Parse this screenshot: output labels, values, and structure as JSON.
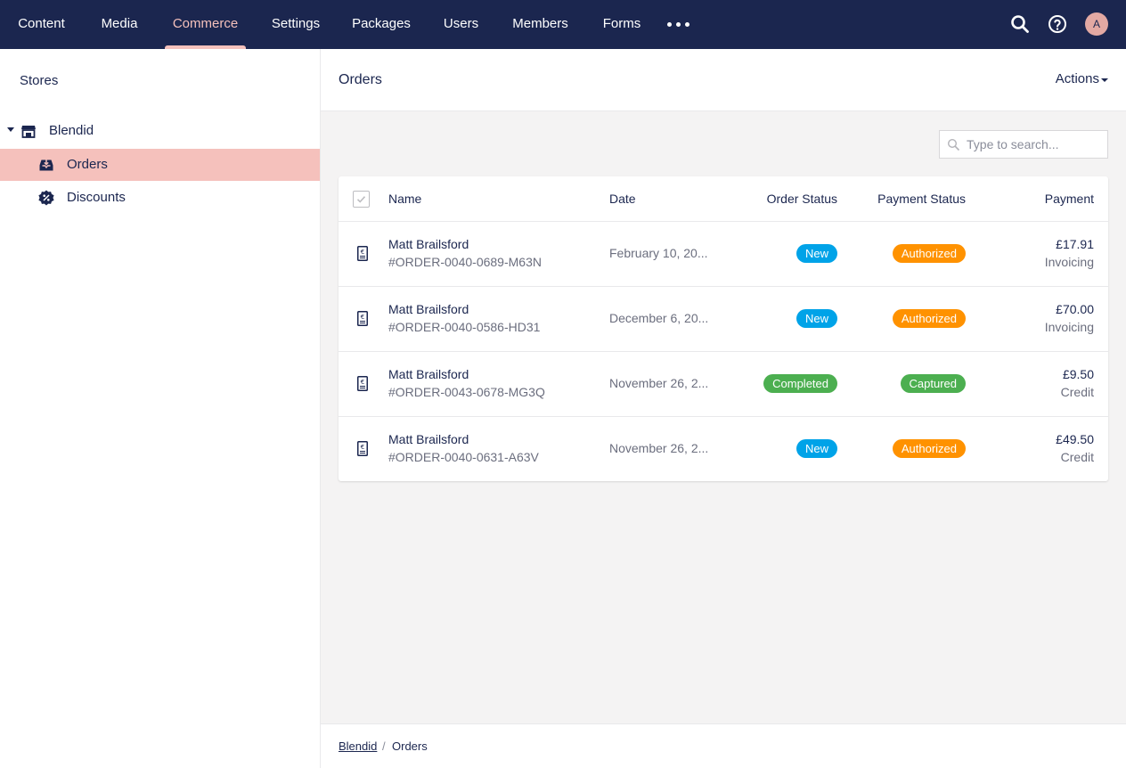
{
  "topnav": {
    "items": [
      "Content",
      "Media",
      "Commerce",
      "Settings",
      "Packages",
      "Users",
      "Members",
      "Forms"
    ],
    "active": "Commerce",
    "more_icon": "ellipsis-icon",
    "search_icon": "search-icon",
    "help_icon": "help-icon",
    "avatar_initial": "A"
  },
  "sidebar": {
    "title": "Stores",
    "store": {
      "label": "Blendid",
      "icon": "store-icon"
    },
    "items": [
      {
        "label": "Orders",
        "icon": "inbox-download-icon",
        "selected": true
      },
      {
        "label": "Discounts",
        "icon": "discount-badge-icon",
        "selected": false
      }
    ]
  },
  "main": {
    "title": "Orders",
    "actions_label": "Actions",
    "search_placeholder": "Type to search...",
    "columns": {
      "name": "Name",
      "date": "Date",
      "order_status": "Order Status",
      "payment_status": "Payment Status",
      "payment": "Payment"
    },
    "orders": [
      {
        "customer": "Matt Brailsford",
        "number": "#ORDER-0040-0689-M63N",
        "date": "February 10, 20...",
        "order_status": "New",
        "payment_status": "Authorized",
        "amount": "£17.91",
        "method": "Invoicing"
      },
      {
        "customer": "Matt Brailsford",
        "number": "#ORDER-0040-0586-HD31",
        "date": "December 6, 20...",
        "order_status": "New",
        "payment_status": "Authorized",
        "amount": "£70.00",
        "method": "Invoicing"
      },
      {
        "customer": "Matt Brailsford",
        "number": "#ORDER-0043-0678-MG3Q",
        "date": "November 26, 2...",
        "order_status": "Completed",
        "payment_status": "Captured",
        "amount": "£9.50",
        "method": "Credit"
      },
      {
        "customer": "Matt Brailsford",
        "number": "#ORDER-0040-0631-A63V",
        "date": "November 26, 2...",
        "order_status": "New",
        "payment_status": "Authorized",
        "amount": "£49.50",
        "method": "Credit"
      }
    ]
  },
  "breadcrumb": {
    "link": "Blendid",
    "separator": "/",
    "current": "Orders"
  },
  "colors": {
    "nav_bg": "#1b264f",
    "accent": "#f5c1bc",
    "status_new": "#00a3e8",
    "status_completed": "#4caf50",
    "status_authorized": "#ff9200",
    "status_captured": "#4caf50"
  }
}
